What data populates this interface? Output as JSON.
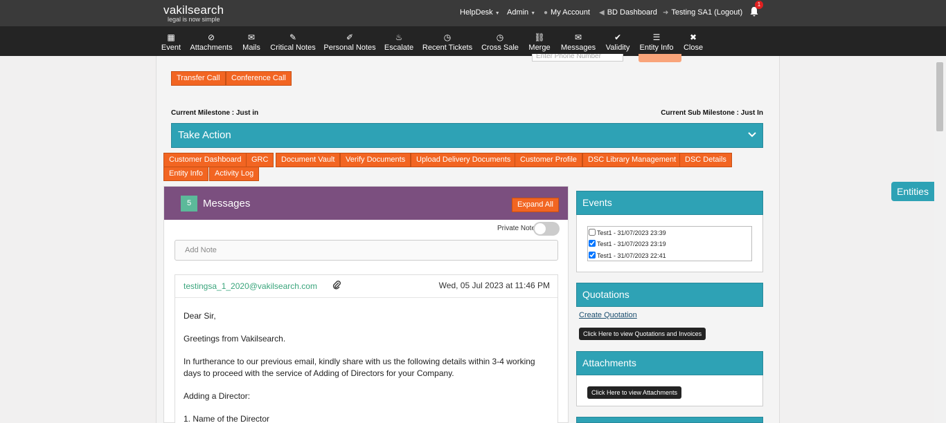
{
  "brand": {
    "name": "vakilsearch",
    "tagline": "legal is now simple"
  },
  "top_nav": {
    "helpdesk": "HelpDesk",
    "admin": "Admin",
    "my_account": "My Account",
    "bd_dashboard": "BD Dashboard",
    "user_logout": "Testing SA1 (Logout)",
    "notification_count": "1"
  },
  "toolbar": {
    "items": [
      {
        "label": "Event",
        "icon": "calendar-icon"
      },
      {
        "label": "Attachments",
        "icon": "paperclip-icon"
      },
      {
        "label": "Mails",
        "icon": "envelope-icon"
      },
      {
        "label": "Critical Notes",
        "icon": "pencil-icon"
      },
      {
        "label": "Personal Notes",
        "icon": "pin-icon"
      },
      {
        "label": "Escalate",
        "icon": "fire-icon"
      },
      {
        "label": "Recent Tickets",
        "icon": "clock-icon"
      },
      {
        "label": "Cross Sale",
        "icon": "clock-icon"
      },
      {
        "label": "Merge",
        "icon": "link-icon"
      },
      {
        "label": "Messages",
        "icon": "envelope-icon"
      },
      {
        "label": "Validity",
        "icon": "check-icon"
      },
      {
        "label": "Entity Info",
        "icon": "list-icon"
      },
      {
        "label": "Close",
        "icon": "x-icon"
      }
    ]
  },
  "call": {
    "phone_placeholder": "Enter Phone Number",
    "transfer": "Transfer Call",
    "conference": "Conference Call"
  },
  "milestone": {
    "current": "Current Milestone : Just in",
    "sub": "Current Sub Milestone : Just In"
  },
  "take_action": "Take Action",
  "action_buttons": [
    "Customer Dashboard",
    "GRC",
    "Document Vault",
    "Verify Documents",
    "Upload Delivery Documents",
    "Customer Profile",
    "DSC Library Management",
    "DSC Details",
    "Entity Info",
    "Activity Log"
  ],
  "messages": {
    "count": "5",
    "title": "Messages",
    "expand_all": "Expand All",
    "private_note": "Private Note",
    "add_note_placeholder": "Add Note",
    "email": {
      "from": "testingsa_1_2020@vakilsearch.com",
      "date": "Wed, 05 Jul 2023 at 11:46 PM",
      "greeting": "Dear Sir,",
      "line1": "Greetings from Vakilsearch.",
      "line2": "In furtherance to our previous email, kindly share with us the following details within 3-4 working days to proceed with the service of Adding of Directors for your Company.",
      "line3": "Adding a Director:",
      "line4": "1. Name of the Director"
    }
  },
  "events": {
    "title": "Events",
    "items": [
      {
        "label": "Test1 - 31/07/2023 23:39",
        "checked": false
      },
      {
        "label": "Test1 - 31/07/2023 23:19",
        "checked": true
      },
      {
        "label": "Test1 - 31/07/2023 22:41",
        "checked": true
      }
    ]
  },
  "quotations": {
    "title": "Quotations",
    "create": "Create Quotation",
    "view": "Click Here to view Quotations and Invoices"
  },
  "attachments": {
    "title": "Attachments",
    "view": "Click Here to view Attachments"
  },
  "entities_tab": "Entities",
  "colors": {
    "orange": "#f26522",
    "teal": "#2ea2b5",
    "purple": "#7b4f7f",
    "green": "#5cb99a",
    "topbar": "#3a3a3a",
    "toolbar": "#242424"
  }
}
